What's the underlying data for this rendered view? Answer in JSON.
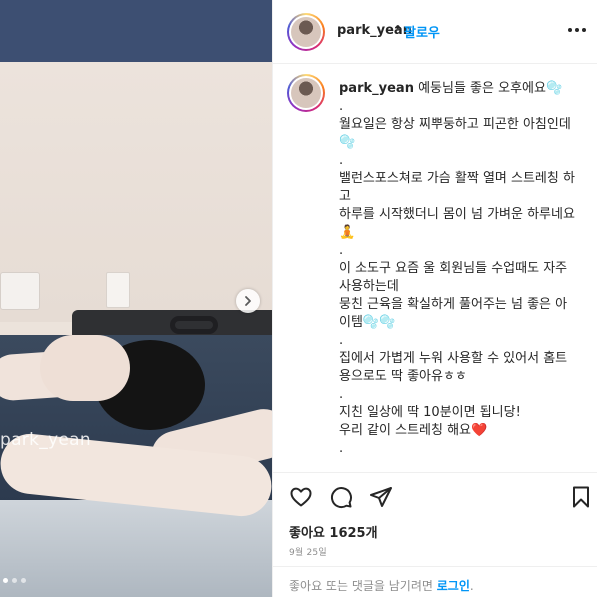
{
  "post": {
    "photo": {
      "watermark": "park_yean",
      "carousel_dots": 3,
      "active_dot": 1
    },
    "header": {
      "username": "park_yean",
      "separator": "•",
      "follow_label": "팔로우"
    },
    "caption": {
      "username": "park_yean",
      "text": " 예둥님들 좋은 오후에요🫧\n.\n월요일은 항상 찌뿌둥하고 피곤한 아침인데🫧\n.\n밸런스포스쳐로 가슴 활짝 열며 스트레칭 하고\n하루를 시작했더니 몸이 넘 가벼운 하루네요🧘\n.\n이 소도구 요즘 울 회원님들 수업때도 자주 사용하는데\n뭉친 근육을 확실하게 풀어주는 넘 좋은 아이템🫧🫧\n.\n집에서 가볍게 누워 사용할 수 있어서 홈트용으로도 딱 좋아유ㅎㅎ\n.\n지친 일상에 딱 10분이면 됩니당!\n우리 같이 스트레칭 해요❤️\n."
    },
    "likes_text": "좋아요 1625개",
    "date": "9월 25일",
    "login_prompt": {
      "text": "좋아요 또는 댓글을 남기려면 ",
      "link": "로그인",
      "suffix": "."
    }
  },
  "icons": {
    "like": "heart-icon",
    "comment": "comment-icon",
    "share": "share-icon",
    "save": "bookmark-icon",
    "more": "more-horizontal-icon",
    "next": "chevron-right-icon"
  },
  "colors": {
    "link_blue": "#0095f6",
    "text": "#262626",
    "muted": "#8e8e8e",
    "border": "#efefef"
  }
}
